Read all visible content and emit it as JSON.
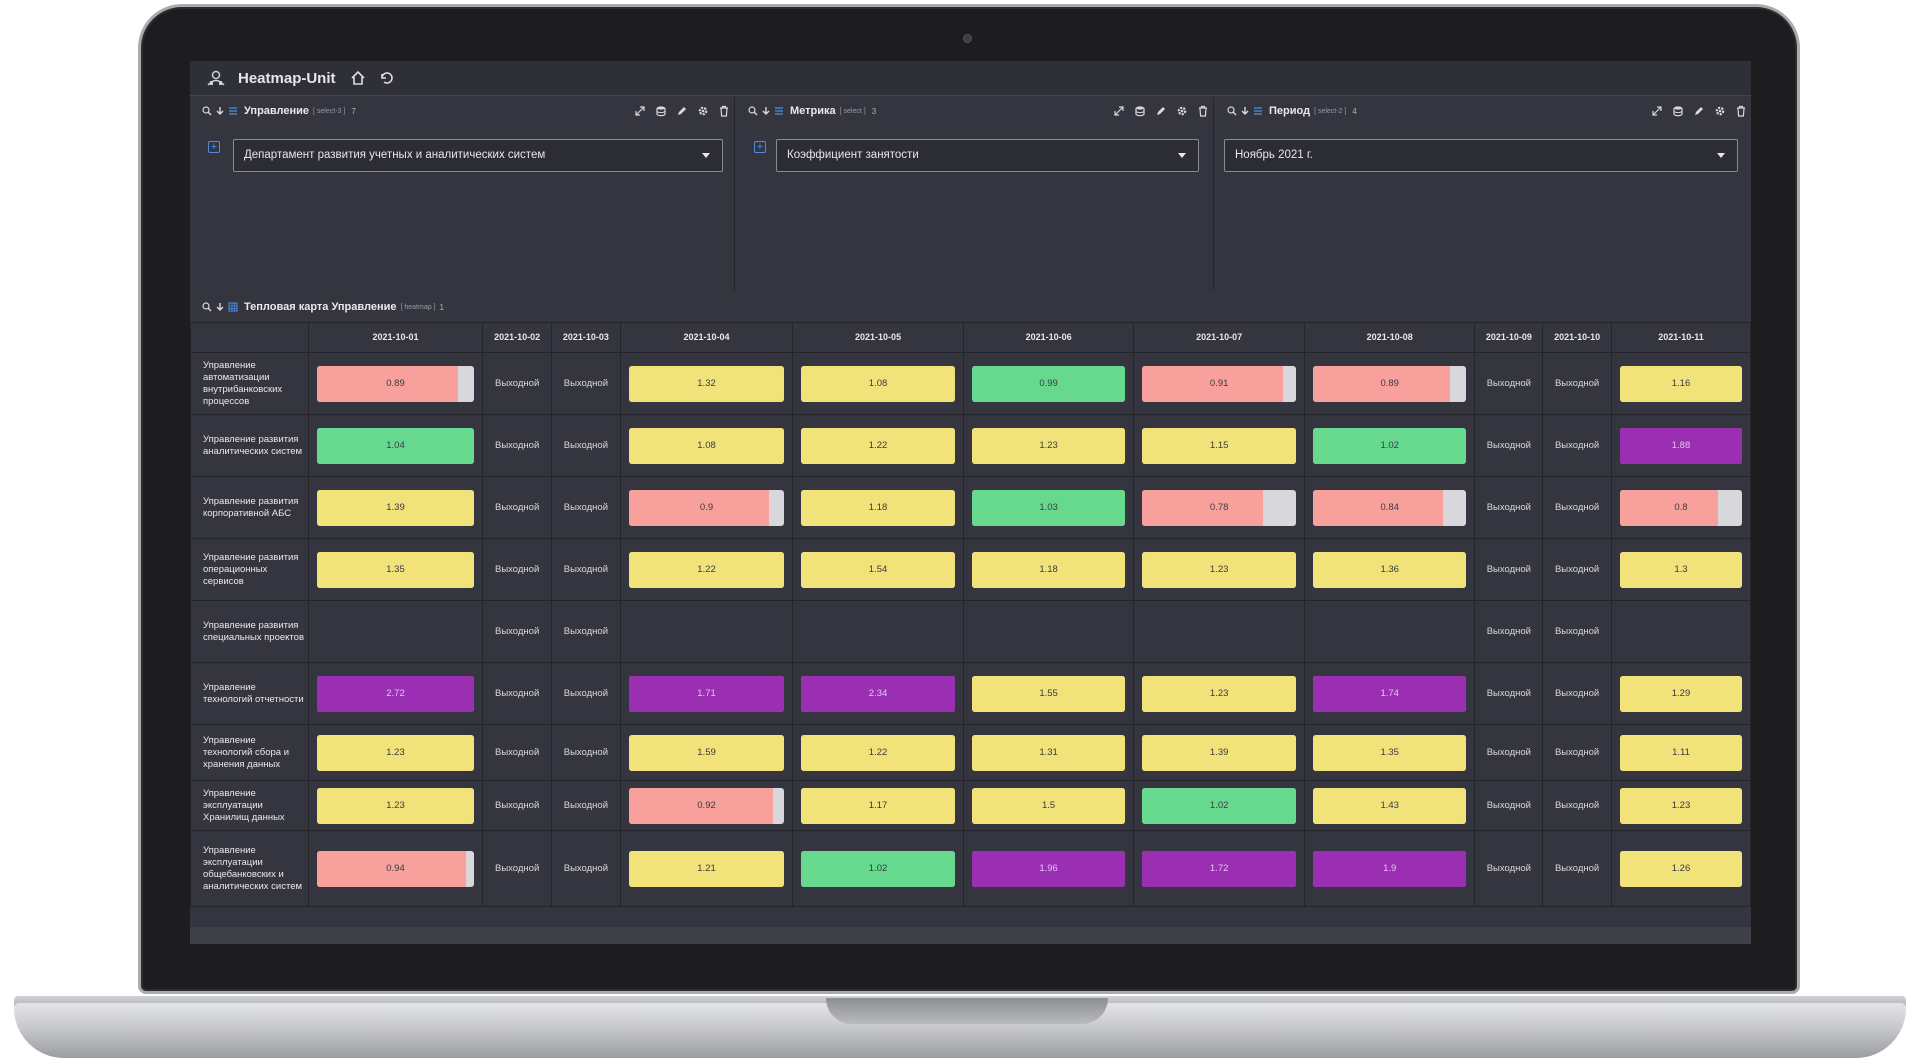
{
  "app": {
    "title": "Heatmap-Unit"
  },
  "colors": {
    "yellow": "#f2e27a",
    "green": "#66d98f",
    "red": "#f7a09c",
    "purple": "#9a2fb3",
    "track": "#d7d7dc"
  },
  "filters": [
    {
      "title": "Управление",
      "meta": "[ select-3 ]",
      "count": "7",
      "value": "Департамент развития учетных и аналитических систем"
    },
    {
      "title": "Метрика",
      "meta": "[ select ]",
      "count": "3",
      "value": "Коэффициент занятости"
    },
    {
      "title": "Период",
      "meta": "[ select-2 ]",
      "count": "4",
      "value": "Ноябрь 2021 г."
    }
  ],
  "heatmap": {
    "title": "Тепловая карта Управление",
    "meta": "[ heatmap ]",
    "count": "1",
    "weekend_label": "Выходной",
    "columns": [
      {
        "label": "2021-10-01",
        "weekend": false
      },
      {
        "label": "2021-10-02",
        "weekend": true
      },
      {
        "label": "2021-10-03",
        "weekend": true
      },
      {
        "label": "2021-10-04",
        "weekend": false
      },
      {
        "label": "2021-10-05",
        "weekend": false
      },
      {
        "label": "2021-10-06",
        "weekend": false
      },
      {
        "label": "2021-10-07",
        "weekend": false
      },
      {
        "label": "2021-10-08",
        "weekend": false
      },
      {
        "label": "2021-10-09",
        "weekend": true
      },
      {
        "label": "2021-10-10",
        "weekend": true
      },
      {
        "label": "2021-10-11",
        "weekend": false
      }
    ],
    "rows": [
      {
        "label": "Управление автоматизации внутрибанковских процессов",
        "values": [
          "0.89",
          "",
          "",
          "1.32",
          "1.08",
          "0.99",
          "0.91",
          "0.89",
          "",
          "",
          "1.16"
        ]
      },
      {
        "label": "Управление развития аналитических систем",
        "values": [
          "1.04",
          "",
          "",
          "1.08",
          "1.22",
          "1.23",
          "1.15",
          "1.02",
          "",
          "",
          "1.88"
        ]
      },
      {
        "label": "Управление развития корпоративной АБС",
        "values": [
          "1.39",
          "",
          "",
          "0.9",
          "1.18",
          "1.03",
          "0.78",
          "0.84",
          "",
          "",
          "0.8"
        ]
      },
      {
        "label": "Управление развития операционных сервисов",
        "values": [
          "1.35",
          "",
          "",
          "1.22",
          "1.54",
          "1.18",
          "1.23",
          "1.36",
          "",
          "",
          "1.3"
        ]
      },
      {
        "label": "Управление развития специальных проектов",
        "values": [
          "",
          "",
          "",
          "",
          "",
          "",
          "",
          "",
          "",
          "",
          ""
        ]
      },
      {
        "label": "Управление технологий отчетности",
        "values": [
          "2.72",
          "",
          "",
          "1.71",
          "2.34",
          "1.55",
          "1.23",
          "1.74",
          "",
          "",
          "1.29"
        ]
      },
      {
        "label": "Управление технологий сбора и хранения данных",
        "values": [
          "1.23",
          "",
          "",
          "1.59",
          "1.22",
          "1.31",
          "1.39",
          "1.35",
          "",
          "",
          "1.11"
        ]
      },
      {
        "label": "Управление эксплуатации Хранилищ данных",
        "values": [
          "1.23",
          "",
          "",
          "0.92",
          "1.17",
          "1.5",
          "1.02",
          "1.43",
          "",
          "",
          "1.23"
        ]
      },
      {
        "label": "Управление эксплуатации общебанковских и аналитических систем",
        "values": [
          "0.94",
          "",
          "",
          "1.21",
          "1.02",
          "1.96",
          "1.72",
          "1.9",
          "",
          "",
          "1.26"
        ]
      }
    ]
  }
}
